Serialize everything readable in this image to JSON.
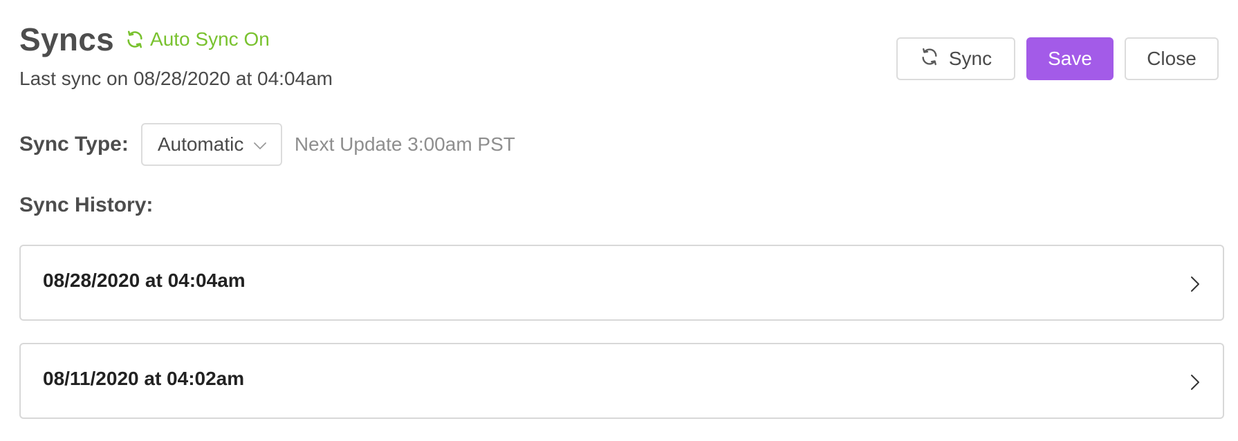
{
  "header": {
    "title": "Syncs",
    "auto_sync_label": "Auto Sync On",
    "auto_sync_icon": "refresh-icon",
    "last_sync": "Last sync on 08/28/2020 at 04:04am"
  },
  "actions": {
    "sync_label": "Sync",
    "sync_icon": "refresh-icon",
    "save_label": "Save",
    "close_label": "Close"
  },
  "sync_type": {
    "label": "Sync Type:",
    "selected": "Automatic",
    "dropdown_icon": "chevron-down-icon",
    "next_update": "Next Update 3:00am PST"
  },
  "history": {
    "label": "Sync History:",
    "items": [
      {
        "date": "08/28/2020 at 04:04am",
        "icon": "chevron-right-icon"
      },
      {
        "date": "08/11/2020 at 04:02am",
        "icon": "chevron-right-icon"
      }
    ]
  },
  "colors": {
    "accent": "#a35be8",
    "status_green": "#79c22f",
    "border": "#dcdcdc",
    "text": "#4a4a4a",
    "muted": "#8e8e8e"
  }
}
